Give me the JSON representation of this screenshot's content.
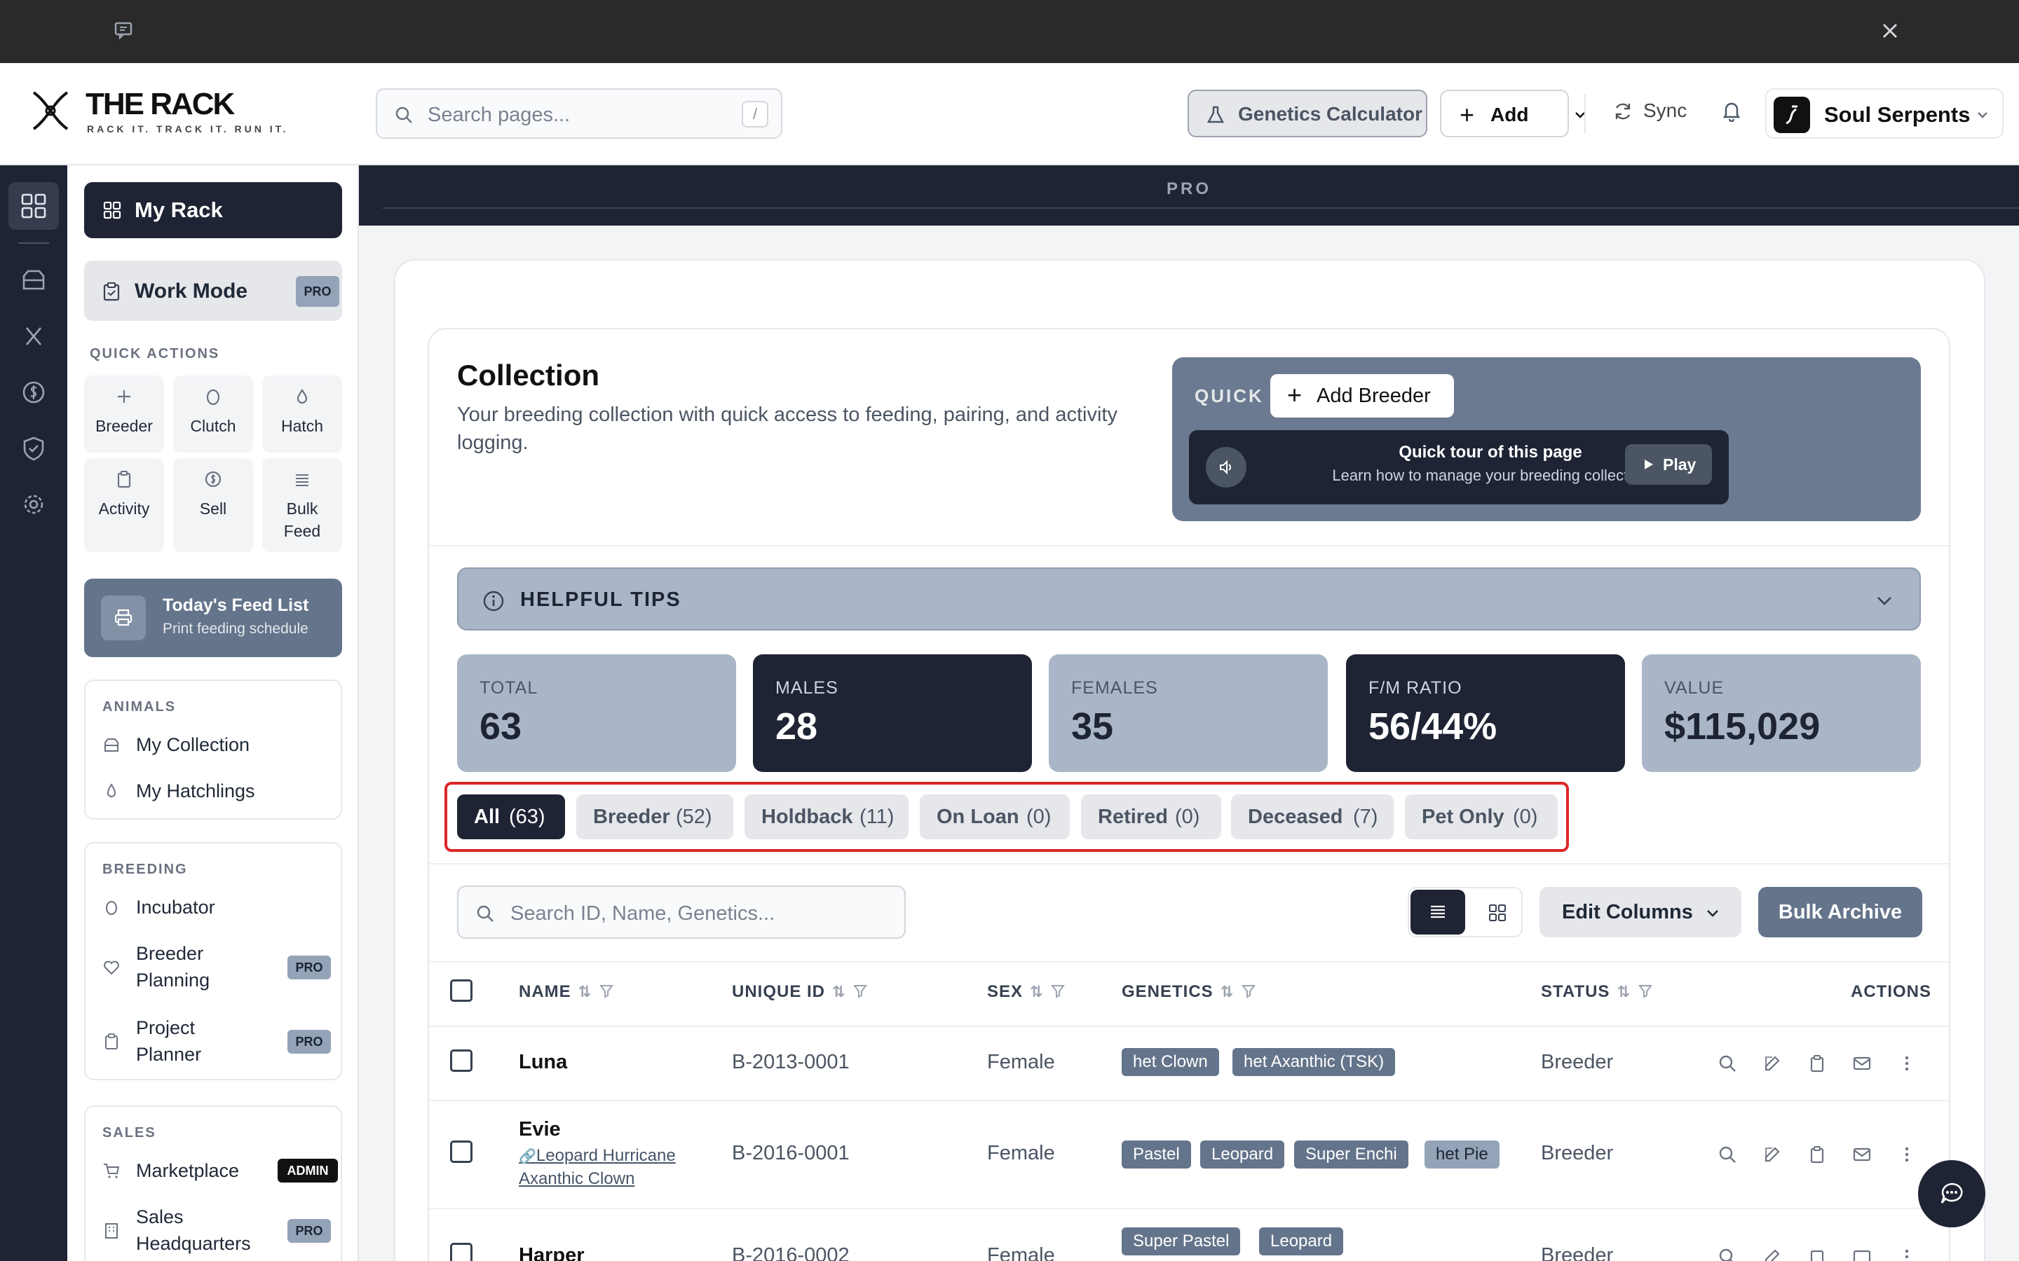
{
  "header": {
    "logo_title": "THE RACK",
    "logo_tagline": "RACK IT. TRACK IT. RUN IT.",
    "search_placeholder": "Search pages...",
    "search_shortcut": "/",
    "genetics_calculator": "Genetics Calculator",
    "add_label": "Add",
    "sync_label": "Sync",
    "account_name": "Soul Serpents"
  },
  "sidebar": {
    "my_rack": "My Rack",
    "work_mode": "Work Mode",
    "pro_badge": "PRO",
    "quick_actions_title": "QUICK ACTIONS",
    "quick_actions": [
      {
        "label": "Breeder",
        "icon": "plus-icon"
      },
      {
        "label": "Clutch",
        "icon": "egg-icon"
      },
      {
        "label": "Hatch",
        "icon": "drop-icon"
      },
      {
        "label": "Activity",
        "icon": "clipboard-icon"
      },
      {
        "label": "Sell",
        "icon": "dollar-icon"
      },
      {
        "label": "Bulk Feed",
        "icon": "list-icon"
      }
    ],
    "feed_list_title": "Today's Feed List",
    "feed_list_sub": "Print feeding schedule",
    "animals_title": "ANIMALS",
    "animals": [
      {
        "label": "My Collection"
      },
      {
        "label": "My Hatchlings"
      }
    ],
    "breeding_title": "BREEDING",
    "breeding": [
      {
        "label": "Incubator"
      },
      {
        "label": "Breeder Planning",
        "badge": "PRO"
      },
      {
        "label": "Project Planner",
        "badge": "PRO"
      }
    ],
    "sales_title": "SALES",
    "sales": [
      {
        "label": "Marketplace",
        "badge": "ADMIN"
      },
      {
        "label": "Sales Headquarters",
        "badge": "PRO"
      }
    ]
  },
  "banner": {
    "label": "PRO"
  },
  "main": {
    "title": "Collection",
    "description": "Your breeding collection with quick access to feeding, pairing, and activity logging.",
    "quick_label": "QUICK",
    "add_breeder": "Add Breeder",
    "tour_title": "Quick tour of this page",
    "tour_sub": "Learn how to manage your breeding collection",
    "play_label": "Play",
    "helpful_tips": "HELPFUL TIPS",
    "stats": [
      {
        "label": "TOTAL",
        "value": "63"
      },
      {
        "label": "MALES",
        "value": "28"
      },
      {
        "label": "FEMALES",
        "value": "35"
      },
      {
        "label": "F/M RATIO",
        "value": "56/44%"
      },
      {
        "label": "VALUE",
        "value": "$115,029"
      }
    ],
    "filters": [
      {
        "label": "All",
        "count": "(63)"
      },
      {
        "label": "Breeder",
        "count": "(52)"
      },
      {
        "label": "Holdback",
        "count": "(11)"
      },
      {
        "label": "On Loan",
        "count": "(0)"
      },
      {
        "label": "Retired",
        "count": "(0)"
      },
      {
        "label": "Deceased",
        "count": "(7)"
      },
      {
        "label": "Pet Only",
        "count": "(0)"
      }
    ],
    "table_search_placeholder": "Search ID, Name, Genetics...",
    "edit_columns": "Edit Columns",
    "bulk_archive": "Bulk Archive",
    "columns": {
      "name": "NAME",
      "unique_id": "UNIQUE ID",
      "sex": "SEX",
      "genetics": "GENETICS",
      "status": "STATUS",
      "actions": "ACTIONS"
    },
    "rows": [
      {
        "name": "Luna",
        "link": "",
        "uid": "B-2013-0001",
        "sex": "Female",
        "genetics": [
          "het Clown",
          "het Axanthic (TSK)"
        ],
        "status": "Breeder"
      },
      {
        "name": "Evie",
        "link": "Leopard Hurricane Axanthic Clown",
        "uid": "B-2016-0001",
        "sex": "Female",
        "genetics": [
          "Pastel",
          "Leopard",
          "Super Enchi",
          "het Pie"
        ],
        "status": "Breeder"
      },
      {
        "name": "Harper",
        "link": "",
        "uid": "B-2016-0002",
        "sex": "Female",
        "genetics": [
          "Super Pastel",
          "Leopard"
        ],
        "status": "Breeder"
      }
    ]
  },
  "colors": {
    "navy": "#1e2433",
    "slate": "#64748b",
    "light_slate": "#aab6c8",
    "highlight": "#dc2626"
  }
}
